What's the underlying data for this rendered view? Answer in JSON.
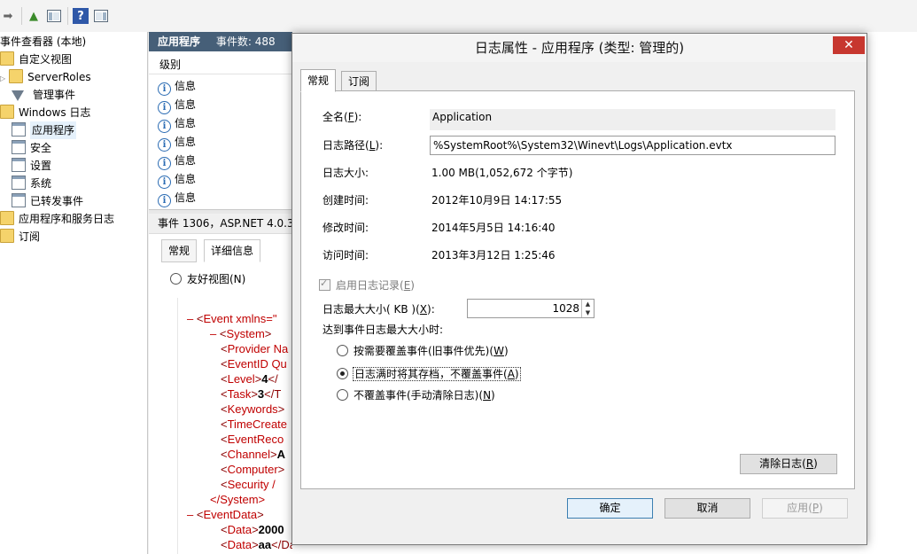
{
  "toolbar": {
    "icons": [
      "forward-arrow-icon",
      "import-log-icon",
      "console-tree-icon",
      "help-icon",
      "action-pane-icon"
    ]
  },
  "tree": {
    "root": "事件查看器 (本地)",
    "custom_views": "自定义视图",
    "server_roles": "ServerRoles",
    "admin_events": "管理事件",
    "windows_logs": "Windows 日志",
    "application": "应用程序",
    "security": "安全",
    "setup": "设置",
    "system": "系统",
    "forwarded": "已转发事件",
    "app_services": "应用程序和服务日志",
    "subscriptions": "订阅"
  },
  "middle": {
    "header_name": "应用程序",
    "header_count": "事件数: 488",
    "col_level": "级别",
    "rows": [
      "信息",
      "信息",
      "信息",
      "信息",
      "信息",
      "信息",
      "信息"
    ],
    "detail_header": "事件 1306，ASP.NET 4.0.3",
    "tab_general": "常规",
    "tab_details": "详细信息",
    "friendly_view": "友好视图(N)",
    "xml": {
      "event": "Event xmlns=\"",
      "system": "System",
      "provider": "Provider Na",
      "eventid": "EventID Qu",
      "level_tag": "Level",
      "level_val": "4",
      "level_close": "</",
      "task_tag": "Task",
      "task_val": "3",
      "task_close": "</T",
      "keywords": "Keywords",
      "timecreated": "TimeCreate",
      "eventrecord": "EventReco",
      "channel_tag": "Channel",
      "channel_val": "A",
      "computer": "Computer",
      "security": "Security /",
      "system_close": "</System>",
      "eventdata": "EventData",
      "data1_tag": "Data",
      "data1_val": "2000",
      "data2_tag": "Data",
      "data2_val": "aa",
      "data2_close": "</Data>"
    }
  },
  "dialog": {
    "title": "日志属性 - 应用程序 (类型: 管理的)",
    "close": "✕",
    "tab_general": "常规",
    "tab_subscribe": "订阅",
    "fullname_label": "全名",
    "fullname_key": "F",
    "fullname_value": "Application",
    "path_label": "日志路径",
    "path_key": "L",
    "path_value": "%SystemRoot%\\System32\\Winevt\\Logs\\Application.evtx",
    "size_label": "日志大小:",
    "size_value": "1.00 MB(1,052,672 个字节)",
    "created_label": "创建时间:",
    "created_value": "2012年10月9日 14:17:55",
    "modified_label": "修改时间:",
    "modified_value": "2014年5月5日 14:16:40",
    "accessed_label": "访问时间:",
    "accessed_value": "2013年3月12日 1:25:46",
    "enable_label": "启用日志记录",
    "enable_key": "E",
    "enable_checked": true,
    "maxsize_label": "日志最大大小( KB )",
    "maxsize_key": "X",
    "maxsize_value": "1028",
    "reach_label": "达到事件日志最大大小时:",
    "opt_overwrite": "按需要覆盖事件(旧事件优先)",
    "opt_overwrite_key": "W",
    "opt_archive": "日志满时将其存档，不覆盖事件",
    "opt_archive_key": "A",
    "opt_nooverwrite": "不覆盖事件(手动清除日志)",
    "opt_nooverwrite_key": "N",
    "selected_option": "archive",
    "clear_button": "清除日志",
    "clear_key": "R",
    "ok_button": "确定",
    "cancel_button": "取消",
    "apply_button": "应用",
    "apply_key": "P"
  }
}
